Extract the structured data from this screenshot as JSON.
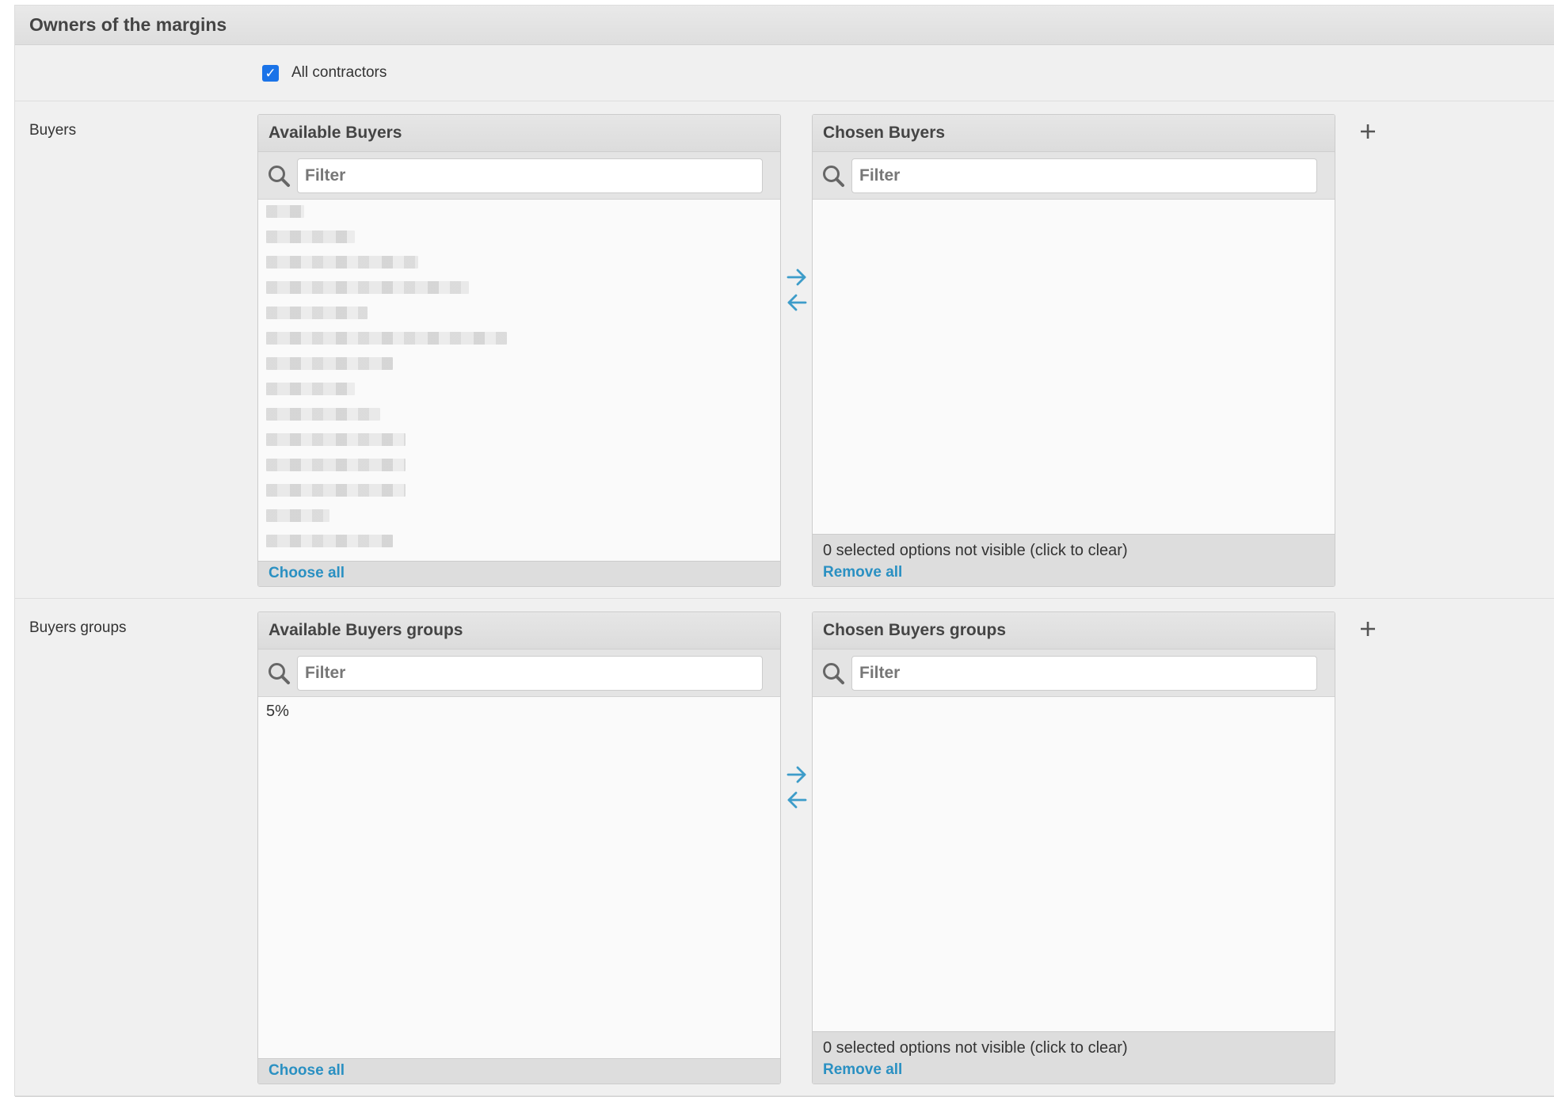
{
  "panel": {
    "title": "Owners of the margins"
  },
  "contractors": {
    "label": "All contractors",
    "checked": true
  },
  "buyers": {
    "row_label": "Buyers",
    "available_title": "Available Buyers",
    "chosen_title": "Chosen Buyers",
    "filter_placeholder": "Filter",
    "available_items_note": "redacted entries",
    "hidden_note": "0 selected options not visible (click to clear)",
    "choose_all": "Choose all",
    "remove_all": "Remove all"
  },
  "buyers_groups": {
    "row_label": "Buyers groups",
    "available_title": "Available Buyers groups",
    "chosen_title": "Chosen Buyers groups",
    "filter_placeholder": "Filter",
    "available_items": [
      "5%"
    ],
    "hidden_note": "0 selected options not visible (click to clear)",
    "choose_all": "Choose all",
    "remove_all": "Remove all"
  },
  "icons": {
    "search": "search-icon",
    "add": "plus-icon",
    "move_right": "arrow-right-icon",
    "move_left": "arrow-left-icon",
    "accent_color": "#2a90c2",
    "checkbox_color": "#1a73e8"
  }
}
